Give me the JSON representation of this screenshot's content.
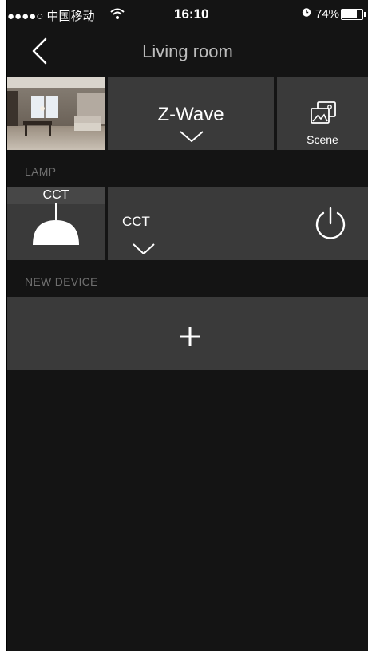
{
  "status_bar": {
    "carrier": "●●●●○ 中国移动",
    "time": "16:10",
    "battery_text": "74%",
    "battery_level": 0.74
  },
  "nav": {
    "title": "Living room",
    "back_icon": "chevron-left-icon"
  },
  "top_row": {
    "protocol_label": "Z-Wave",
    "scene_label": "Scene"
  },
  "sections": {
    "lamp": "LAMP",
    "new_device": "NEW DEVICE"
  },
  "lamp_device": {
    "type_label": "CCT",
    "control_label": "CCT"
  },
  "icons": [
    "wifi-icon",
    "alarm-icon",
    "battery-icon",
    "chevron-down-icon",
    "scene-icon",
    "lamp-icon",
    "power-icon",
    "plus-icon"
  ],
  "colors": {
    "background": "#141414",
    "tile": "#3a3a3a",
    "section_label": "#6f6f6f",
    "title": "#bdbdbd"
  }
}
